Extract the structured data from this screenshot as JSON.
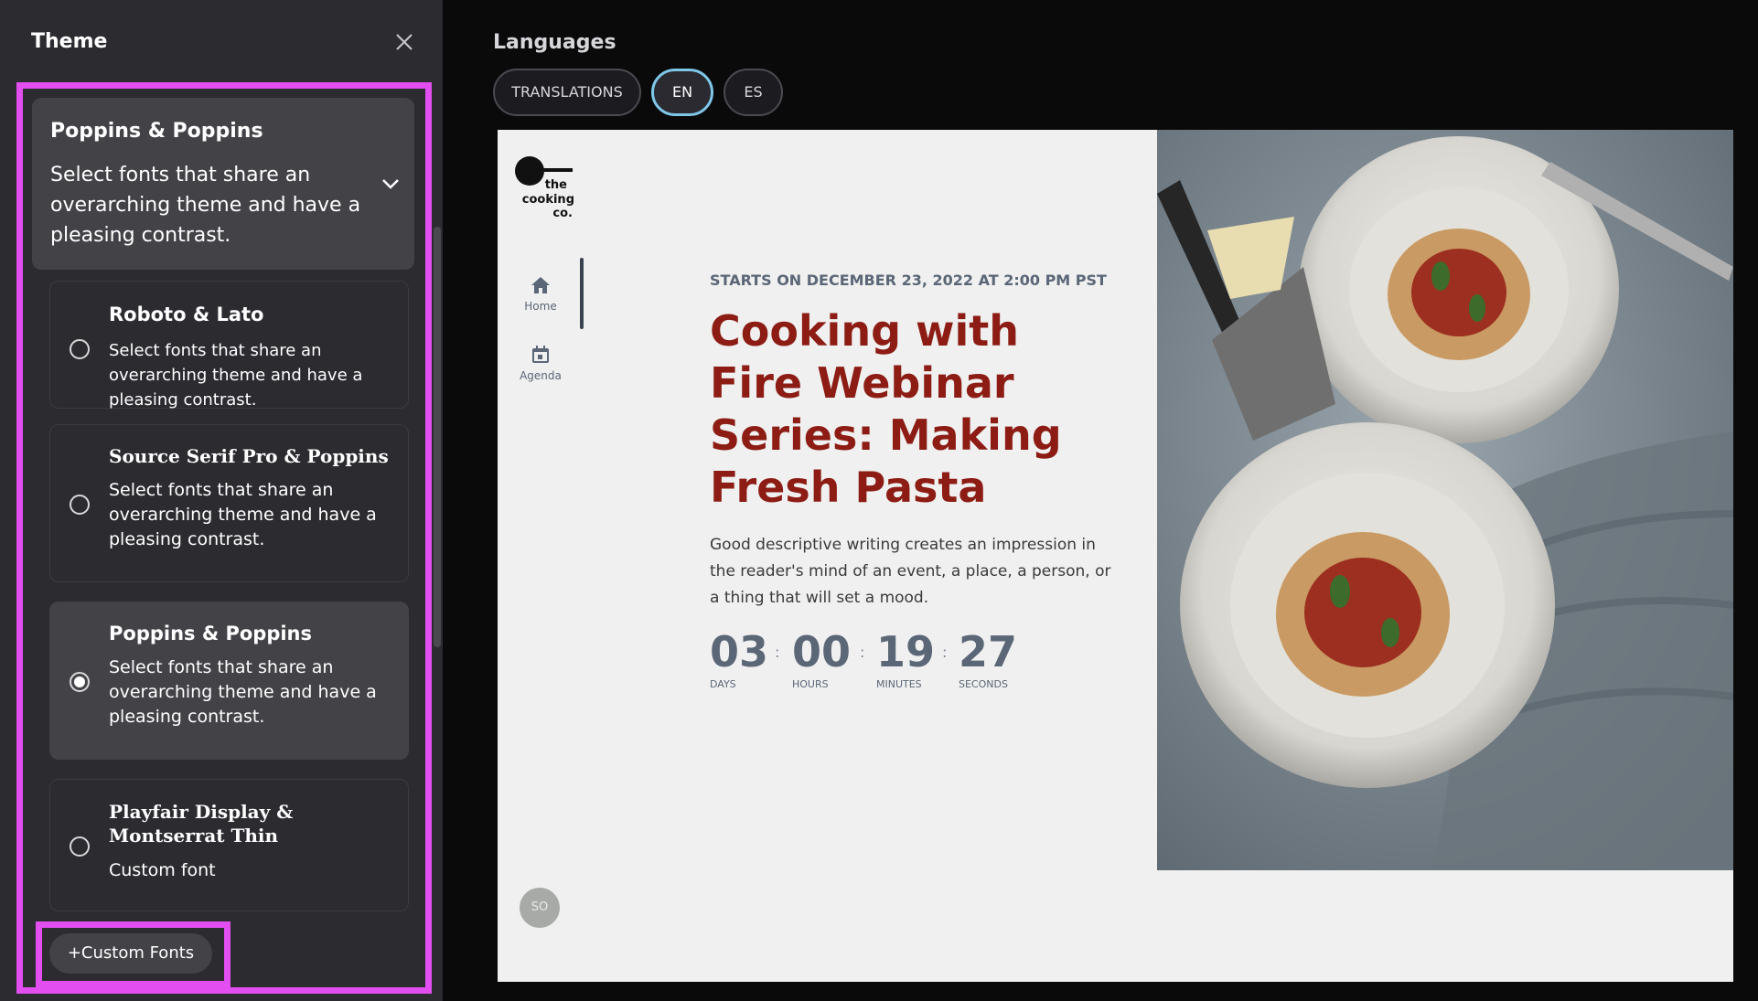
{
  "sidebar": {
    "title": "Theme",
    "selected": {
      "name": "Poppins & Poppins",
      "description": "Select fonts that share an overarching theme and have a pleasing contrast."
    },
    "fonts": [
      {
        "name": "Roboto & Lato",
        "description": "Select fonts that share an overarching theme and have a pleasing contrast.",
        "selected": false
      },
      {
        "name": "Source Serif Pro & Poppins",
        "description": "Select fonts that share an overarching theme and have a pleasing contrast.",
        "selected": false
      },
      {
        "name": "Poppins & Poppins",
        "description": "Select fonts that share an overarching theme and have a pleasing contrast.",
        "selected": true
      },
      {
        "name": "Playfair Display & Montserrat Thin",
        "description": "Custom font",
        "selected": false
      }
    ],
    "custom_fonts_label": "+Custom Fonts",
    "highlight_color": "#e24ef0"
  },
  "languages": {
    "title": "Languages",
    "pills": [
      {
        "label": "TRANSLATIONS",
        "active": false
      },
      {
        "label": "EN",
        "active": true
      },
      {
        "label": "ES",
        "active": false
      }
    ]
  },
  "preview": {
    "logo_text": [
      "the",
      "cooking",
      "co."
    ],
    "nav": [
      {
        "label": "Home",
        "icon": "home-icon"
      },
      {
        "label": "Agenda",
        "icon": "calendar-icon"
      }
    ],
    "starts": "STARTS ON DECEMBER 23, 2022 AT 2:00 PM PST",
    "title": "Cooking with Fire Webinar Series: Making Fresh Pasta",
    "description": "Good descriptive writing creates an impression in the reader's mind of an event, a place, a person, or a thing that will set a mood.",
    "countdown": [
      {
        "value": "03",
        "label": "DAYS"
      },
      {
        "value": "00",
        "label": "HOURS"
      },
      {
        "value": "19",
        "label": "MINUTES"
      },
      {
        "value": "27",
        "label": "SECONDS"
      }
    ],
    "countdown_sep": ":",
    "avatar_initials": "SO",
    "title_color": "#8c1c14"
  }
}
